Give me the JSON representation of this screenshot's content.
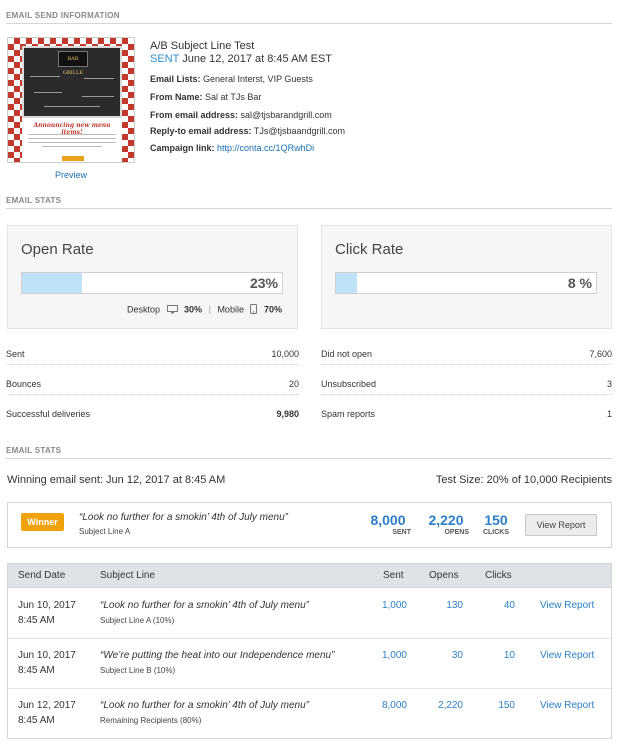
{
  "send_info": {
    "section_title": "EMAIL SEND INFORMATION",
    "thumbnail": {
      "logo_text": "BAR GRILLE",
      "heading": "Announcing new menu items!"
    },
    "preview_label": "Preview",
    "title": "A/B Subject Line Test",
    "status": "SENT",
    "sent_date": "June 12, 2017 at 8:45 AM EST",
    "rows": [
      {
        "label": "Email Lists:",
        "value": "General Interst, VIP Guests",
        "link": false
      },
      {
        "label": "From Name:",
        "value": "Sal at TJs Bar",
        "link": false
      },
      {
        "label": "From email address:",
        "value": "sal@tjsbarandgrill.com",
        "link": false
      },
      {
        "label": "Reply-to email address:",
        "value": "TJs@tjsbaandgrill.com",
        "link": false
      },
      {
        "label": "Campaign link:",
        "value": "http://conta.cc/1QRwhDi",
        "link": true
      }
    ]
  },
  "email_stats": {
    "section_title": "EMAIL STATS",
    "open_rate": {
      "title": "Open Rate",
      "value_label": "23%",
      "value": 23,
      "desktop_label": "Desktop",
      "desktop_value": "30%",
      "mobile_label": "Mobile",
      "mobile_value": "70%"
    },
    "click_rate": {
      "title": "Click Rate",
      "value_label": "8 %",
      "value": 8
    },
    "left_rows": [
      {
        "label": "Sent",
        "value": "10,000",
        "bold": false
      },
      {
        "label": "Bounces",
        "value": "20",
        "bold": false
      },
      {
        "label": "Successful deliveries",
        "value": "9,980",
        "bold": true
      }
    ],
    "right_rows": [
      {
        "label": "Did not open",
        "value": "7,600"
      },
      {
        "label": "Unsubscribed",
        "value": "3"
      },
      {
        "label": "Spam reports",
        "value": "1"
      }
    ]
  },
  "ab_stats": {
    "section_title": "EMAIL STATS",
    "winning_sent_label": "Winning email sent: Jun 12, 2017 at 8:45 AM",
    "test_size_label": "Test Size: 20% of 10,000 Recipients",
    "winner": {
      "badge": "Winner",
      "subject": "“Look no further for a smokin’ 4th of July menu”",
      "variant": "Subject Line A",
      "sent": "8,000",
      "sent_label": "SENT",
      "opens": "2,220",
      "opens_label": "OPENS",
      "clicks": "150",
      "clicks_label": "CLICKS",
      "view_report": "View Report"
    },
    "table": {
      "headers": [
        "Send Date",
        "Subject Line",
        "Sent",
        "Opens",
        "Clicks"
      ],
      "rows": [
        {
          "date": "Jun 10, 2017",
          "time": "8:45 AM",
          "subject": "“Look no further for a smokin’ 4th of July menu”",
          "variant": "Subject Line A (10%)",
          "sent": "1,000",
          "opens": "130",
          "clicks": "40",
          "action": "View Report"
        },
        {
          "date": "Jun 10, 2017",
          "time": "8:45 AM",
          "subject": "“We’re putting the heat into our Independence menu”",
          "variant": "Subject Line B (10%)",
          "sent": "1,000",
          "opens": "30",
          "clicks": "10",
          "action": "View Report"
        },
        {
          "date": "Jun 12, 2017",
          "time": "8:45 AM",
          "subject": "“Look no further for a smokin’ 4th of July menu”",
          "variant": "Remaining Recipients (80%)",
          "sent": "8,000",
          "opens": "2,220",
          "clicks": "150",
          "action": "View Report"
        }
      ]
    }
  }
}
